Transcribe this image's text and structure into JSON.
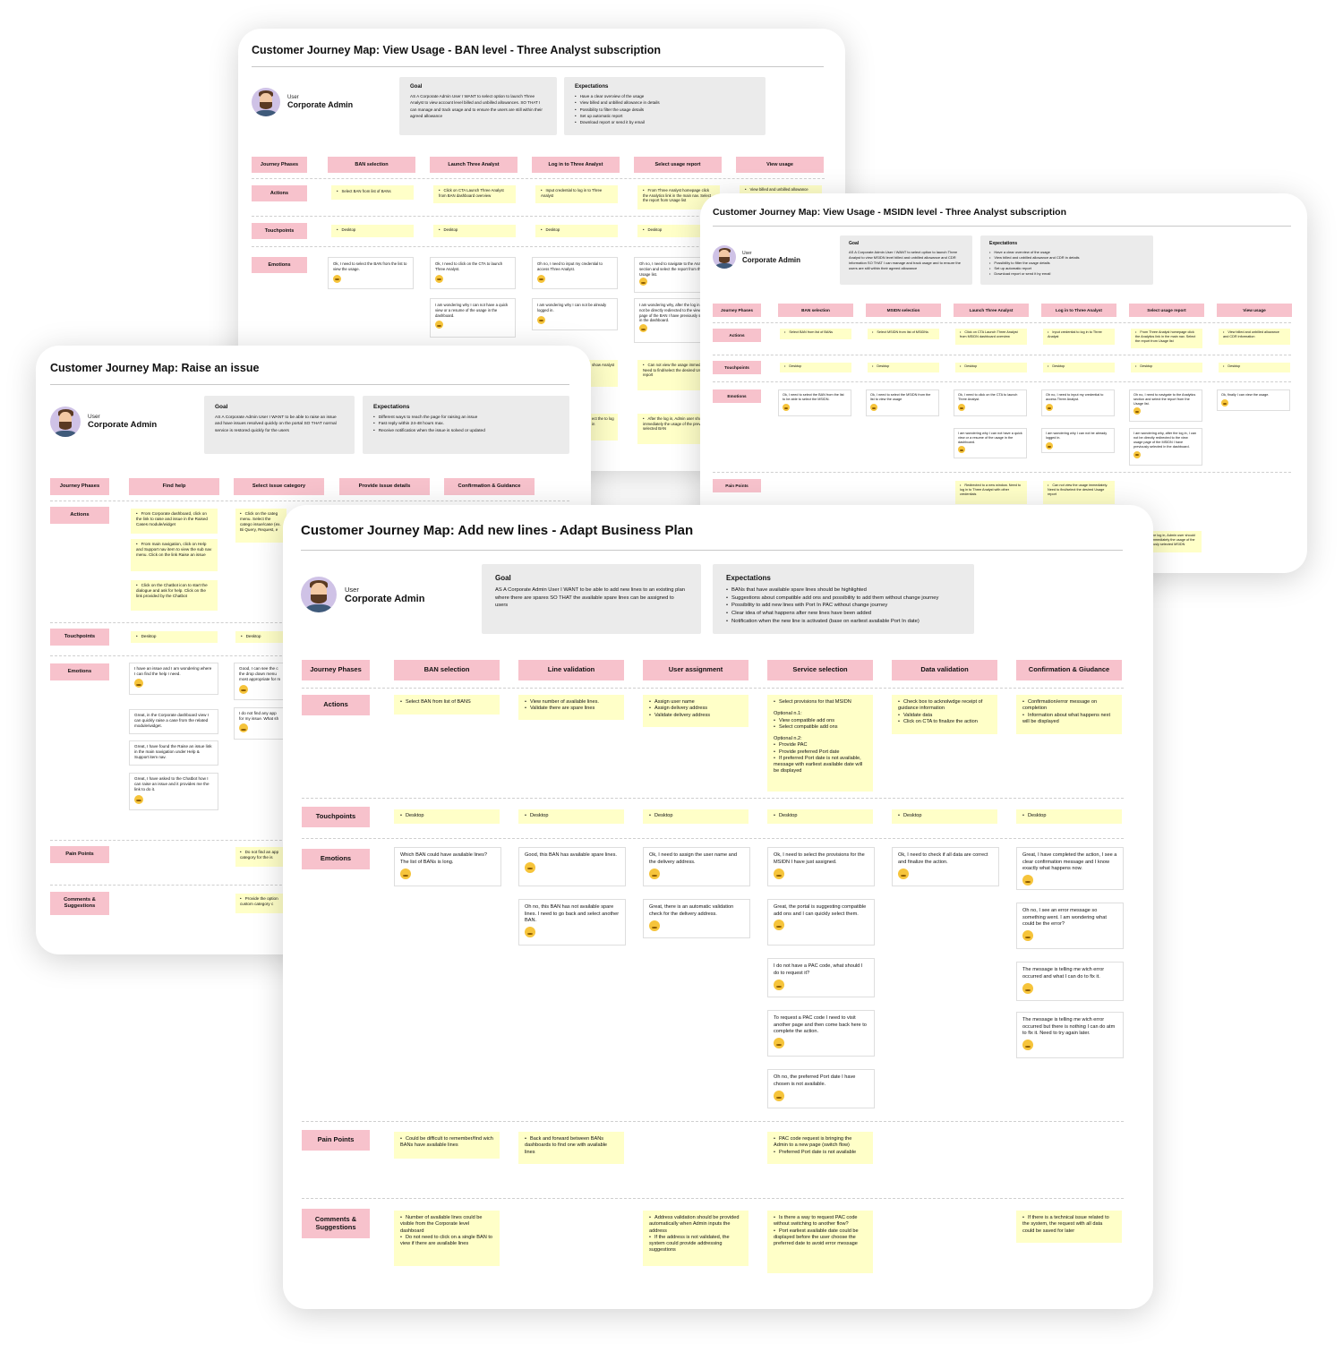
{
  "board_ban": {
    "title": "Customer Journey Map: View Usage - BAN level - Three Analyst subscription",
    "user_label": "User",
    "user_name": "Corporate Admin",
    "goal_title": "Goal",
    "goal_text": "AS A Corporate Admin User I WANT to select option to launch Three Analyst to view account level billed and unbilled allowances. SO THAT I can manage and track usage and to ensure the users are still within their agreed allowance",
    "exp_title": "Expectations",
    "expectations": [
      "Have a clear overview of the usage",
      "View billed and unbilled allowance in details",
      "Possibility to filter the usage details",
      "Set up automatic report",
      "Download report or send it by email"
    ],
    "row_labels": [
      "Journey Phases",
      "Actions",
      "Touchpoints",
      "Emotions"
    ],
    "phases": [
      "BAN selection",
      "Launch Three Analyst",
      "Log in to Three Analyst",
      "Select usage report",
      "View usage"
    ],
    "actions": [
      "Select BAN from list of BANs",
      "Click on CTA Launch Three Analyst from BAN dashboard overview",
      "Input credential to log in to Three Analyst",
      "From Three Analyst homepage click the Analytics link in the main nav. Select the report from Usage list",
      "View billed and unbilled allowance"
    ],
    "touch": "Desktop",
    "emotions_1": [
      "Ok, I need to select the BAN from the list to view the usage.",
      "Ok, I need to click on the CTA to launch Three Analyst.",
      "Oh no, I need to input my credential to access Three Analyst.",
      "Oh no, I need to navigate to the Analytics section and select the report from the Usage list."
    ],
    "emotions_2": [
      "I am wondering why I can not have a quick view or a resume of the usage in the dashboard.",
      "I am wondering why I can not be already logged in.",
      "I am wondering why, after the log in, I can not be directly redirected to the view usage page of the BAN I have previously selected in the dashboard."
    ],
    "pain_peek": [
      "show Analyst",
      "Can not view the usage immediately. Need to find/select the desired Usage report"
    ],
    "comment_peek": [
      "ect the to log in",
      "After the log in, Admin user should see immediately the usage of the previously selected BAN"
    ]
  },
  "board_msidn": {
    "title": "Customer Journey Map: View Usage - MSIDN level - Three Analyst subscription",
    "user_label": "User",
    "user_name": "Corporate Admin",
    "goal_title": "Goal",
    "goal_text": "AS A Corporate Admin User I WANT to select option to launch Three Analyst to view MSIDN level billed and unbilled allowance and CDR information SO THAT I can manage and track usage and to ensure the users are still within their agreed allowance",
    "exp_title": "Expectations",
    "expectations": [
      "Have a clear overview of the usage",
      "View billed and unbilled allowance and CDR in details",
      "Possibility to filter the usage details",
      "Set up automatic report",
      "Download report or send it by email"
    ],
    "row_labels": [
      "Journey Phases",
      "Actions",
      "Touchpoints",
      "Emotions",
      "Pain Points"
    ],
    "phases": [
      "BAN selection",
      "MSIDN selection",
      "Launch Three Analyst",
      "Log in to Three Analyst",
      "Select usage report",
      "View usage"
    ],
    "actions": [
      "Select BAN from list of BANs",
      "Select MSIDN from list of MSIDNs",
      "Click on CTA Launch Three Analyst from MSIDN dashboard overview",
      "Input credential to log in to Three Analyst",
      "From Three Analyst homepage click the Analytics link in the main nav. Select the report from Usage list",
      "View billed and unbilled allowance and CDR information"
    ],
    "touch": "Desktop",
    "emotions_1": [
      "Ok, I need to select the BAN from the list to be able to select the MSIDN.",
      "Ok, I need to select the MSIDN from the list to view the usage",
      "Ok, I need to click on the CTA to launch Three Analyst.",
      "Oh no, I need to input my credential to access Three Analyst.",
      "Oh no, I need to navigate to the Analytics section and select the report from the Usage list.",
      "Ok, finally I can view the usage."
    ],
    "emotions_2": [
      "I am wondering why I can not have a quick view or a resume of the usage in the dashboard.",
      "I am wondering why I can not be already logged in.",
      "I am wondering why, after the log in, I can not be directly redirected to the view usage page of the MSIDN I have previously selected in the dashboard."
    ],
    "pains": [
      "Redirected to a new window. Need to log in to Three Analyst with other credentials",
      "Can not view the usage immediately. Need to find/select the desired Usage report"
    ],
    "comment_peek": "the log in, Admin user should immediately the usage of the ously selected MSIDN"
  },
  "board_issue": {
    "title": "Customer Journey Map: Raise an issue",
    "user_label": "User",
    "user_name": "Corporate Admin",
    "goal_title": "Goal",
    "goal_text": "AS A Corporate Admin User I WANT to be able to raise an issue and have issues resolved quickly on the portal SO THAT normal service is restored quickly for the users",
    "exp_title": "Expectations",
    "expectations": [
      "Different ways to reach the page for raising an issue",
      "Fast reply within 24-48 hours max.",
      "Receive notification when the issue is solved or updated"
    ],
    "row_labels": [
      "Journey Phases",
      "Actions",
      "Touchpoints",
      "Emotions",
      "Pain Points",
      "Comments & Suggestions"
    ],
    "phases": [
      "Find help",
      "Select issue category",
      "Provide issue details",
      "Confirmation & Guidance"
    ],
    "actions": [
      "From Corporate dashboard, click on the link to raise and issue in the Raised Cases module/widget",
      "From main navigation, click on Help and Support nav item to view the sub nav menu. Click on the link Raise an issue",
      "Click on the Chatbot icon to start the dialogue and ask for help. Click on the link provided by the Chatbot"
    ],
    "action_peek": "Click on the categ menu. Select the catego issue/case (ex. Bi Query, Request, e",
    "touch": "Desktop",
    "emotions": [
      "I have an issue and I am wondering where I can find the help I need.",
      "Great, in the Corporate dashboard view I can quickly raise a case from the related module/widget.",
      "Great, I have found the Raise an issue link in the main navigation under Help & Support item nav.",
      "Great, I have asked to the Chatbot how I can raise an issue and it provides me the link to do it."
    ],
    "emotions_peek": [
      "Good, I can see the c the drop down menu most appropriate for m",
      "I do not find any app for my issue. What sh"
    ],
    "pain_peek": "Do not find an app category for the is",
    "comment_peek": "Provide the option custom category c"
  },
  "board_lines": {
    "title": "Customer Journey Map: Add new lines - Adapt Business Plan",
    "user_label": "User",
    "user_name": "Corporate Admin",
    "goal_title": "Goal",
    "goal_text": "AS A Corporate Admin User I WANT to be able to add new lines to an existing plan where there are spares SO THAT the available spare lines can be assigned to users",
    "exp_title": "Expectations",
    "expectations": [
      "BANs that have available spare lines should be highlighted",
      "Suggestions about compatible add ons and possibility to add them without change journey",
      "Possibility to add new lines with Port In PAC without change journey",
      "Clear idea of what happens after new lines have been added",
      "Notification when the new line is activated (base on earliest available Port In date)"
    ],
    "row_labels": [
      "Journey Phases",
      "Actions",
      "Touchpoints",
      "Emotions",
      "Pain Points",
      "Comments & Suggestions"
    ],
    "phases": [
      "BAN selection",
      "Line validation",
      "User assignment",
      "Service selection",
      "Data validation",
      "Confirmation & Giudance"
    ],
    "actions": [
      [
        "Select BAN from list of BANS"
      ],
      [
        "View number of available lines.",
        "Validate there are spare lines"
      ],
      [
        "Assign user name",
        "Assign delivery address",
        "Validate delivery address"
      ],
      [],
      [
        "Check box to acknolwdge receipt of guidance information",
        "Validate data",
        "Click on CTA to finalize the action"
      ],
      [
        "Confirmation/error message on completion",
        "Information about what happens next will be displayed"
      ]
    ],
    "service_action": {
      "main": "Select provisions for that MSIDN",
      "opt1_title": "Optional n.1:",
      "opt1": [
        "View compatible add ons",
        "Select compatible add ons"
      ],
      "opt2_title": "Optional n.2:",
      "opt2": [
        "Provide PAC",
        "Provide preferred Port date",
        "If preferred Port date is not available, message with earliest available date will be displayed"
      ]
    },
    "touch": "Desktop",
    "emotions": [
      [
        "Which BAN could have available lines? The list of BANs is long."
      ],
      [
        "Good, this BAN has available spare lines.",
        "Oh no, this BAN has not available spare lines. I need to go back and select another BAN."
      ],
      [
        "Ok, I need to assign the user name and the delivery address.",
        "Great, there is an automatic validation check for the delivery address."
      ],
      [
        "Ok, I need to select the provisions for the MSIDN I have just assigned.",
        "Great, the portal is suggesting compatible add ons and I can quickly select them.",
        "I do not have a PAC code, what should I do to request it?",
        "To request a PAC code I need to visit another page and then come back here to complete the action.",
        "Oh no, the preferred Port date I have chosen is not available."
      ],
      [
        "Ok, I need to check if all data are correct and finalize the action."
      ],
      [
        "Great, I have completed the action, I see a clear confirmation message and I know exactly what happens now.",
        "Oh no, I see an error message so something went. I am wondering what could be the error?",
        "The message is telling me wich error occurred and what I can do to fix it.",
        "The message is telling me wich error occurred but there is nothing I can do atm to fix it. Need to try again later."
      ]
    ],
    "pains": [
      [
        "Could be difficult to remember/find wich BANs have available lines"
      ],
      [
        "Back and forward between BANs dashboards to find one with available lines"
      ],
      [],
      [
        "PAC code request is bringing the Admin to a new page (switch flow)",
        "Preferred Port date is not available"
      ],
      [],
      []
    ],
    "comments": [
      [
        "Number of available lines could be visible from the Corporate level dashboard",
        "Do not need to click on a single BAN to view if there are available lines"
      ],
      [],
      [
        "Address validation should be provided automatically when Admin inputs the address",
        "If the address is not validated, the system could provide addressing suggestions"
      ],
      [
        "Is there a way to request PAC code without switching to another flow?",
        "Port earliest available date could be displayed before the user choose the preferred date to avoid error message"
      ],
      [],
      [
        "If there is a technical issue related to the system, the request with all data could be saved for later"
      ]
    ]
  }
}
